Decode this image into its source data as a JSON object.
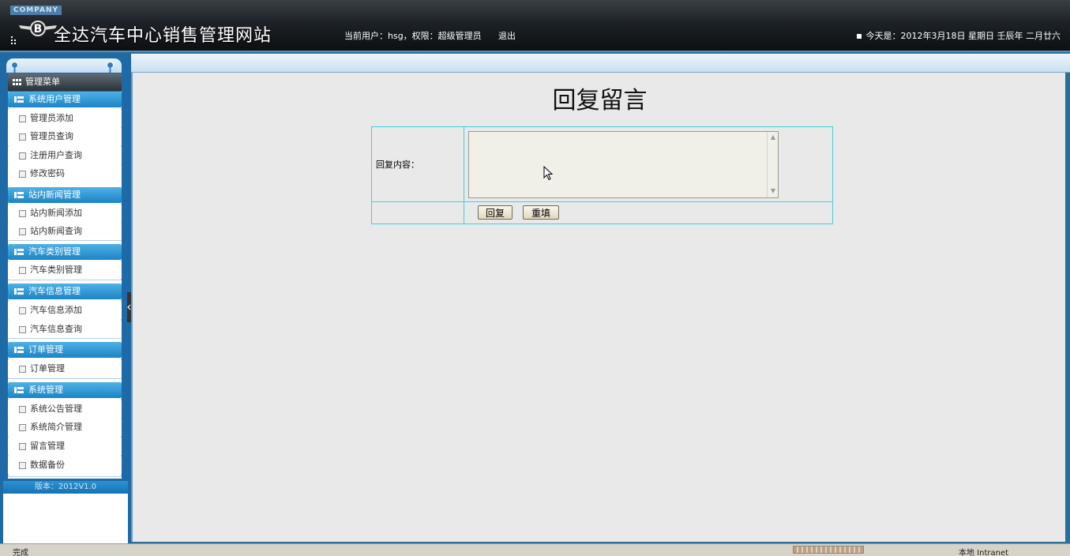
{
  "header": {
    "company": "COMPANY",
    "title": "全达汽车中心销售管理网站",
    "user_info": "当前用户：hsg，权限：超级管理员",
    "logout": "退出",
    "date": "今天是：2012年3月18日 星期日 壬辰年 二月廿六"
  },
  "sidebar": {
    "title": "管理菜单",
    "groups": [
      {
        "label": "系统用户管理",
        "items": [
          "管理员添加",
          "管理员查询",
          "注册用户查询",
          "修改密码"
        ]
      },
      {
        "label": "站内新闻管理",
        "items": [
          "站内新闻添加",
          "站内新闻查询"
        ]
      },
      {
        "label": "汽车类别管理",
        "items": [
          "汽车类别管理"
        ]
      },
      {
        "label": "汽车信息管理",
        "items": [
          "汽车信息添加",
          "汽车信息查询"
        ]
      },
      {
        "label": "订单管理",
        "items": [
          "订单管理"
        ]
      },
      {
        "label": "系统管理",
        "items": [
          "系统公告管理",
          "系统简介管理",
          "留言管理",
          "数据备份"
        ]
      }
    ],
    "version": "版本：2012V1.0"
  },
  "main": {
    "heading": "回复留言",
    "reply_label": "回复内容：",
    "reply_value": "",
    "submit_label": "回复",
    "reset_label": "重填"
  },
  "statusbar": {
    "left": "完成",
    "right": "本地 Intranet"
  }
}
